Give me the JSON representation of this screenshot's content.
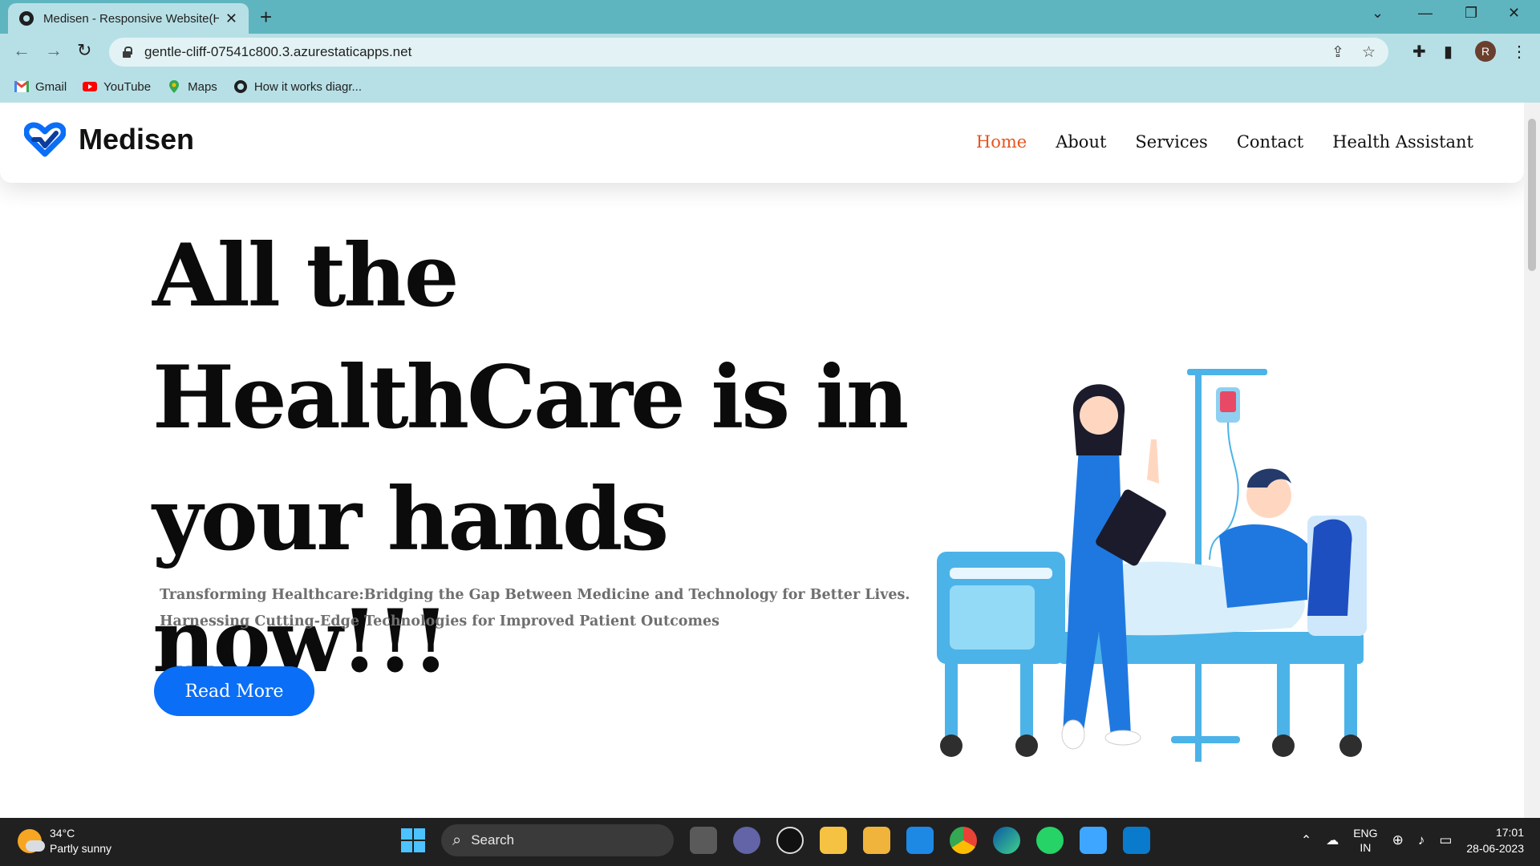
{
  "browser": {
    "tab_title": "Medisen - Responsive Website(H",
    "url": "gentle-cliff-07541c800.3.azurestaticapps.net",
    "profile_initial": "R",
    "bookmarks": [
      {
        "label": "Gmail",
        "icon": "gmail-icon"
      },
      {
        "label": "YouTube",
        "icon": "youtube-icon"
      },
      {
        "label": "Maps",
        "icon": "maps-icon"
      },
      {
        "label": "How it works diagr...",
        "icon": "globe-icon"
      }
    ]
  },
  "site": {
    "brand": "Medisen",
    "nav": [
      "Home",
      "About",
      "Services",
      "Contact",
      "Health Assistant"
    ],
    "active_nav": "Home",
    "hero": {
      "title": "All the HealthCare is in your hands now!!!",
      "subtitle": "Transforming Healthcare:Bridging the Gap Between Medicine and Technology for Better Lives. Harnessing Cutting-Edge Technologies for Improved Patient Outcomes",
      "cta": "Read More"
    }
  },
  "taskbar": {
    "temperature": "34°C",
    "weather": "Partly sunny",
    "search_label": "Search",
    "language": "ENG",
    "region": "IN",
    "time": "17:01",
    "date": "28-06-2023"
  },
  "colors": {
    "accent": "#0a6ef7",
    "nav_active": "#e8541e",
    "browser_frame": "#5fb5bf"
  }
}
